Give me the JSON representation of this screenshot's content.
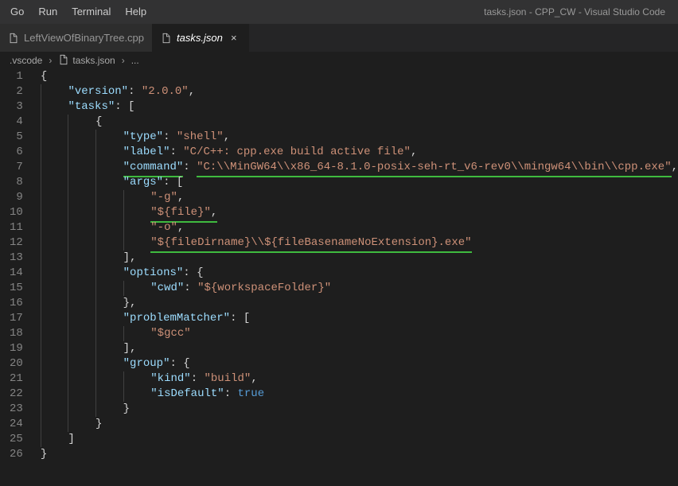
{
  "window": {
    "title": "tasks.json - CPP_CW - Visual Studio Code"
  },
  "menubar": {
    "items": [
      "Go",
      "Run",
      "Terminal",
      "Help"
    ]
  },
  "tabs": [
    {
      "label": "LeftViewOfBinaryTree.cpp",
      "active": false
    },
    {
      "label": "tasks.json",
      "active": true
    }
  ],
  "breadcrumbs": [
    ".vscode",
    "tasks.json",
    "..."
  ],
  "code_lines": [
    {
      "n": 1,
      "indent": 0,
      "segs": [
        {
          "t": "{",
          "c": "brace"
        }
      ]
    },
    {
      "n": 2,
      "indent": 1,
      "segs": [
        {
          "t": "\"version\"",
          "c": "key"
        },
        {
          "t": ": ",
          "c": "brace"
        },
        {
          "t": "\"2.0.0\"",
          "c": "str"
        },
        {
          "t": ",",
          "c": "brace"
        }
      ]
    },
    {
      "n": 3,
      "indent": 1,
      "segs": [
        {
          "t": "\"tasks\"",
          "c": "key"
        },
        {
          "t": ": [",
          "c": "brace"
        }
      ]
    },
    {
      "n": 4,
      "indent": 2,
      "segs": [
        {
          "t": "{",
          "c": "brace"
        }
      ]
    },
    {
      "n": 5,
      "indent": 3,
      "segs": [
        {
          "t": "\"type\"",
          "c": "key"
        },
        {
          "t": ": ",
          "c": "brace"
        },
        {
          "t": "\"shell\"",
          "c": "str"
        },
        {
          "t": ",",
          "c": "brace"
        }
      ]
    },
    {
      "n": 6,
      "indent": 3,
      "segs": [
        {
          "t": "\"label\"",
          "c": "key"
        },
        {
          "t": ": ",
          "c": "brace"
        },
        {
          "t": "\"C/C++: cpp.exe build active file\"",
          "c": "str"
        },
        {
          "t": ",",
          "c": "brace"
        }
      ]
    },
    {
      "n": 7,
      "indent": 3,
      "segs": [
        {
          "t": "\"command\"",
          "c": "key",
          "u": true
        },
        {
          "t": ": ",
          "c": "brace"
        },
        {
          "t": "\"C:\\\\MinGW64\\\\x86_64-8.1.0-posix-seh-rt_v6-rev0\\\\mingw64\\\\bin\\\\cpp.exe\"",
          "c": "str",
          "u": true
        },
        {
          "t": ",",
          "c": "brace"
        }
      ]
    },
    {
      "n": 8,
      "indent": 3,
      "segs": [
        {
          "t": "\"args\"",
          "c": "key"
        },
        {
          "t": ": [",
          "c": "brace"
        }
      ]
    },
    {
      "n": 9,
      "indent": 4,
      "segs": [
        {
          "t": "\"-g\"",
          "c": "str"
        },
        {
          "t": ",",
          "c": "brace"
        }
      ]
    },
    {
      "n": 10,
      "indent": 4,
      "segs": [
        {
          "t": "\"${file}\"",
          "c": "str",
          "u": true
        },
        {
          "t": ",",
          "c": "brace",
          "u": true
        }
      ]
    },
    {
      "n": 11,
      "indent": 4,
      "segs": [
        {
          "t": "\"-o\"",
          "c": "str"
        },
        {
          "t": ",",
          "c": "brace"
        }
      ]
    },
    {
      "n": 12,
      "indent": 4,
      "segs": [
        {
          "t": "\"${fileDirname}\\\\${fileBasenameNoExtension}.exe\"",
          "c": "str",
          "u": true
        }
      ]
    },
    {
      "n": 13,
      "indent": 3,
      "segs": [
        {
          "t": "],",
          "c": "brace"
        }
      ]
    },
    {
      "n": 14,
      "indent": 3,
      "segs": [
        {
          "t": "\"options\"",
          "c": "key"
        },
        {
          "t": ": {",
          "c": "brace"
        }
      ]
    },
    {
      "n": 15,
      "indent": 4,
      "segs": [
        {
          "t": "\"cwd\"",
          "c": "key"
        },
        {
          "t": ": ",
          "c": "brace"
        },
        {
          "t": "\"${workspaceFolder}\"",
          "c": "str"
        }
      ]
    },
    {
      "n": 16,
      "indent": 3,
      "segs": [
        {
          "t": "},",
          "c": "brace"
        }
      ]
    },
    {
      "n": 17,
      "indent": 3,
      "segs": [
        {
          "t": "\"problemMatcher\"",
          "c": "key"
        },
        {
          "t": ": [",
          "c": "brace"
        }
      ]
    },
    {
      "n": 18,
      "indent": 4,
      "segs": [
        {
          "t": "\"$gcc\"",
          "c": "str"
        }
      ]
    },
    {
      "n": 19,
      "indent": 3,
      "segs": [
        {
          "t": "],",
          "c": "brace"
        }
      ]
    },
    {
      "n": 20,
      "indent": 3,
      "segs": [
        {
          "t": "\"group\"",
          "c": "key"
        },
        {
          "t": ": {",
          "c": "brace"
        }
      ]
    },
    {
      "n": 21,
      "indent": 4,
      "segs": [
        {
          "t": "\"kind\"",
          "c": "key"
        },
        {
          "t": ": ",
          "c": "brace"
        },
        {
          "t": "\"build\"",
          "c": "str"
        },
        {
          "t": ",",
          "c": "brace"
        }
      ]
    },
    {
      "n": 22,
      "indent": 4,
      "segs": [
        {
          "t": "\"isDefault\"",
          "c": "key"
        },
        {
          "t": ": ",
          "c": "brace"
        },
        {
          "t": "true",
          "c": "bool"
        }
      ]
    },
    {
      "n": 23,
      "indent": 3,
      "segs": [
        {
          "t": "}",
          "c": "brace"
        }
      ]
    },
    {
      "n": 24,
      "indent": 2,
      "segs": [
        {
          "t": "}",
          "c": "brace"
        }
      ]
    },
    {
      "n": 25,
      "indent": 1,
      "segs": [
        {
          "t": "]",
          "c": "brace"
        }
      ]
    },
    {
      "n": 26,
      "indent": 0,
      "segs": [
        {
          "t": "}",
          "c": "brace"
        }
      ]
    }
  ]
}
